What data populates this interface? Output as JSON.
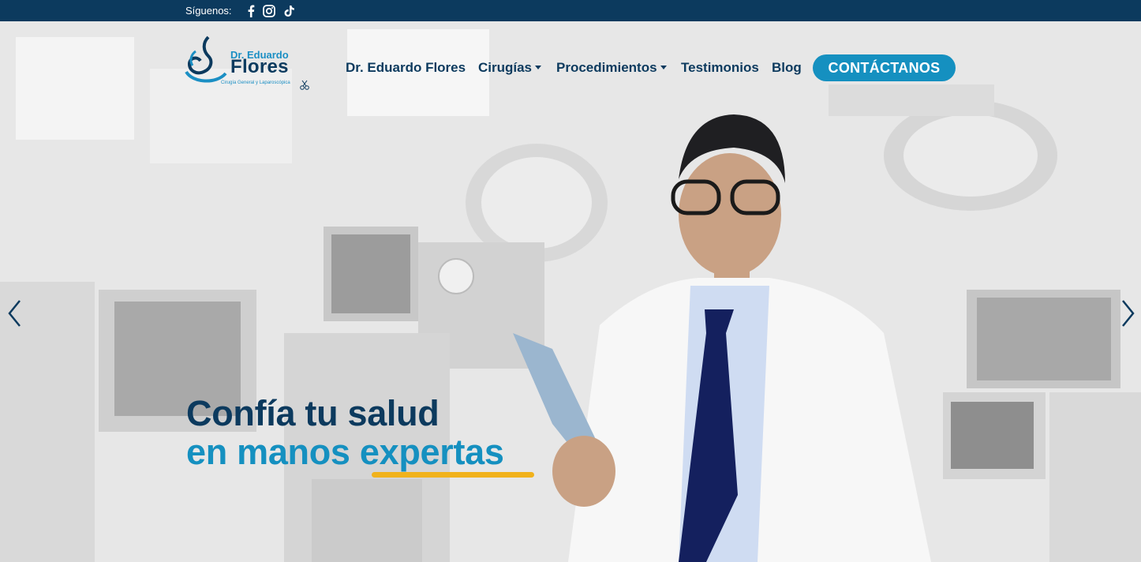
{
  "topbar": {
    "follow_label": "Síguenos:",
    "social": [
      "facebook-icon",
      "instagram-icon",
      "tiktok-icon"
    ]
  },
  "logo": {
    "prefix": "Dr. Eduardo",
    "name": "Flores",
    "tagline": "Cirugía General y Laparoscópica"
  },
  "nav": {
    "items": [
      {
        "label": "Dr. Eduardo Flores",
        "dropdown": false
      },
      {
        "label": "Cirugías",
        "dropdown": true
      },
      {
        "label": "Procedimientos",
        "dropdown": true
      },
      {
        "label": "Testimonios",
        "dropdown": false
      },
      {
        "label": "Blog",
        "dropdown": false
      }
    ],
    "cta_label": "CONTÁCTANOS"
  },
  "hero": {
    "line1": "Confía tu salud",
    "line2_a": "en manos ",
    "line2_b": "expertas",
    "slide_count": 2,
    "active_slide": 1
  },
  "colors": {
    "navy": "#0c3a5e",
    "blue": "#1590c0",
    "accent": "#f1b21c"
  }
}
